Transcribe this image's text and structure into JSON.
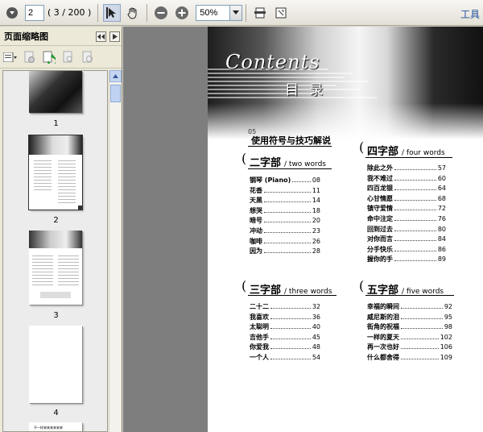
{
  "toolbar": {
    "page_number": "2",
    "page_total": "( 3 / 200 )",
    "zoom": "50%",
    "tools_label": "工具"
  },
  "sidebar": {
    "title": "页面缩略图",
    "thumbnails": [
      {
        "label": "1"
      },
      {
        "label": "2"
      },
      {
        "label": "3"
      },
      {
        "label": "4"
      }
    ],
    "next_thumb_caption": "不一样来来来来来来"
  },
  "page": {
    "cover_title": "Contents",
    "cover_sub": "目 录",
    "usage_num": "05",
    "usage_title": "使用符号与技巧解说",
    "sections": [
      {
        "zh": "二字部",
        "en": "/ two words",
        "entries": [
          {
            "name": "钢琴 (Piano)",
            "page": "08"
          },
          {
            "name": "花香",
            "page": "11"
          },
          {
            "name": "天黑",
            "page": "14"
          },
          {
            "name": "想哭",
            "page": "18"
          },
          {
            "name": "暗号",
            "page": "20"
          },
          {
            "name": "冲动",
            "page": "23"
          },
          {
            "name": "咖啡",
            "page": "26"
          },
          {
            "name": "因为",
            "page": "28"
          }
        ]
      },
      {
        "zh": "三字部",
        "en": "/ three words",
        "entries": [
          {
            "name": "二十二",
            "page": "32"
          },
          {
            "name": "我喜欢",
            "page": "36"
          },
          {
            "name": "太聪明",
            "page": "40"
          },
          {
            "name": "吉他手",
            "page": "45"
          },
          {
            "name": "你爱我",
            "page": "48"
          },
          {
            "name": "一个人",
            "page": "54"
          }
        ]
      },
      {
        "zh": "四字部",
        "en": "/ four words",
        "entries": [
          {
            "name": "除此之外",
            "page": "57"
          },
          {
            "name": "我不难过",
            "page": "60"
          },
          {
            "name": "四百龙银",
            "page": "64"
          },
          {
            "name": "心甘情愿",
            "page": "68"
          },
          {
            "name": "镇守爱情",
            "page": "72"
          },
          {
            "name": "命中注定",
            "page": "76"
          },
          {
            "name": "回到过去",
            "page": "80"
          },
          {
            "name": "对你而言",
            "page": "84"
          },
          {
            "name": "分手快乐",
            "page": "86"
          },
          {
            "name": "握你的手",
            "page": "89"
          }
        ]
      },
      {
        "zh": "五字部",
        "en": "/ five words",
        "entries": [
          {
            "name": "幸福的瞬间",
            "page": "92"
          },
          {
            "name": "威尼斯的泪",
            "page": "95"
          },
          {
            "name": "街角的祝福",
            "page": "98"
          },
          {
            "name": "一样的夏天",
            "page": "102"
          },
          {
            "name": "再一次也好",
            "page": "106"
          },
          {
            "name": "什么都舍得",
            "page": "109"
          }
        ]
      }
    ]
  }
}
